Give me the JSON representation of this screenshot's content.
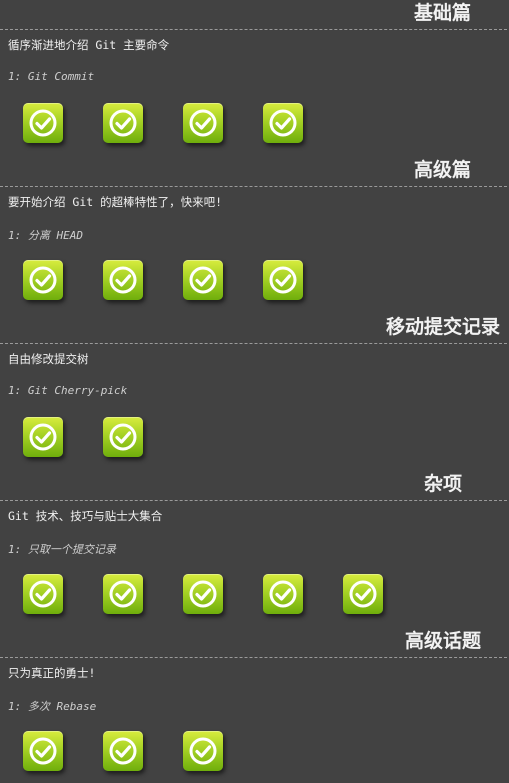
{
  "sections": [
    {
      "title": "基础篇",
      "description": "循序渐进地介绍 Git 主要命令",
      "sub_number": "1:",
      "sub_title": "Git Commit",
      "levels_completed": 4
    },
    {
      "title": "高级篇",
      "description": "要开始介绍 Git 的超棒特性了，快来吧!",
      "sub_number": "1:",
      "sub_title": "分离 HEAD",
      "levels_completed": 4
    },
    {
      "title": "移动提交记录",
      "description": "自由修改提交树",
      "sub_number": "1:",
      "sub_title": "Git Cherry-pick",
      "levels_completed": 2
    },
    {
      "title": "杂项",
      "description": "Git 技术、技巧与贴士大集合",
      "sub_number": "1:",
      "sub_title": "只取一个提交记录",
      "levels_completed": 5
    },
    {
      "title": "高级话题",
      "description": "只为真正的勇士!",
      "sub_number": "1:",
      "sub_title": "多次 Rebase",
      "levels_completed": 3
    }
  ],
  "badge_icon": "check-circle-icon",
  "colors": {
    "background": "#424242",
    "badge_top": "#d8ec3e",
    "badge_bottom": "#6fae0c",
    "check": "#ffffff"
  }
}
